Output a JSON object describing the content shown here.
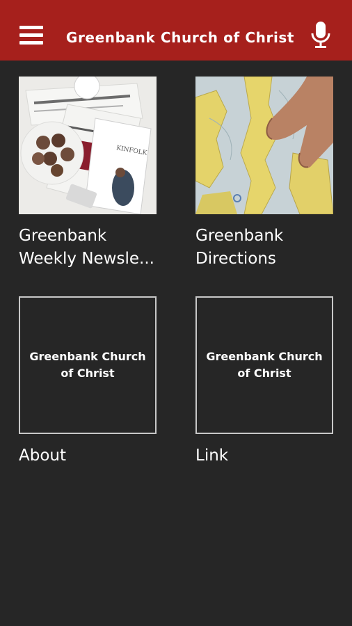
{
  "app_bar": {
    "title": "Greenbank Church of Christ",
    "menu_icon": "hamburger-menu-icon",
    "mic_icon": "microphone-icon",
    "background_color": "#a6201c"
  },
  "tiles": [
    {
      "label_line1": "Greenbank",
      "label_line2": "Weekly Newsle...",
      "image": "newspapers-photo"
    },
    {
      "label_line1": "Greenbank",
      "label_line2": "Directions",
      "image": "map-photo"
    },
    {
      "label": "About",
      "thumb_text": "Greenbank Church of Christ"
    },
    {
      "label": "Link",
      "thumb_text": "Greenbank Church of Christ"
    }
  ],
  "colors": {
    "background": "#262626",
    "text": "#ffffff"
  }
}
